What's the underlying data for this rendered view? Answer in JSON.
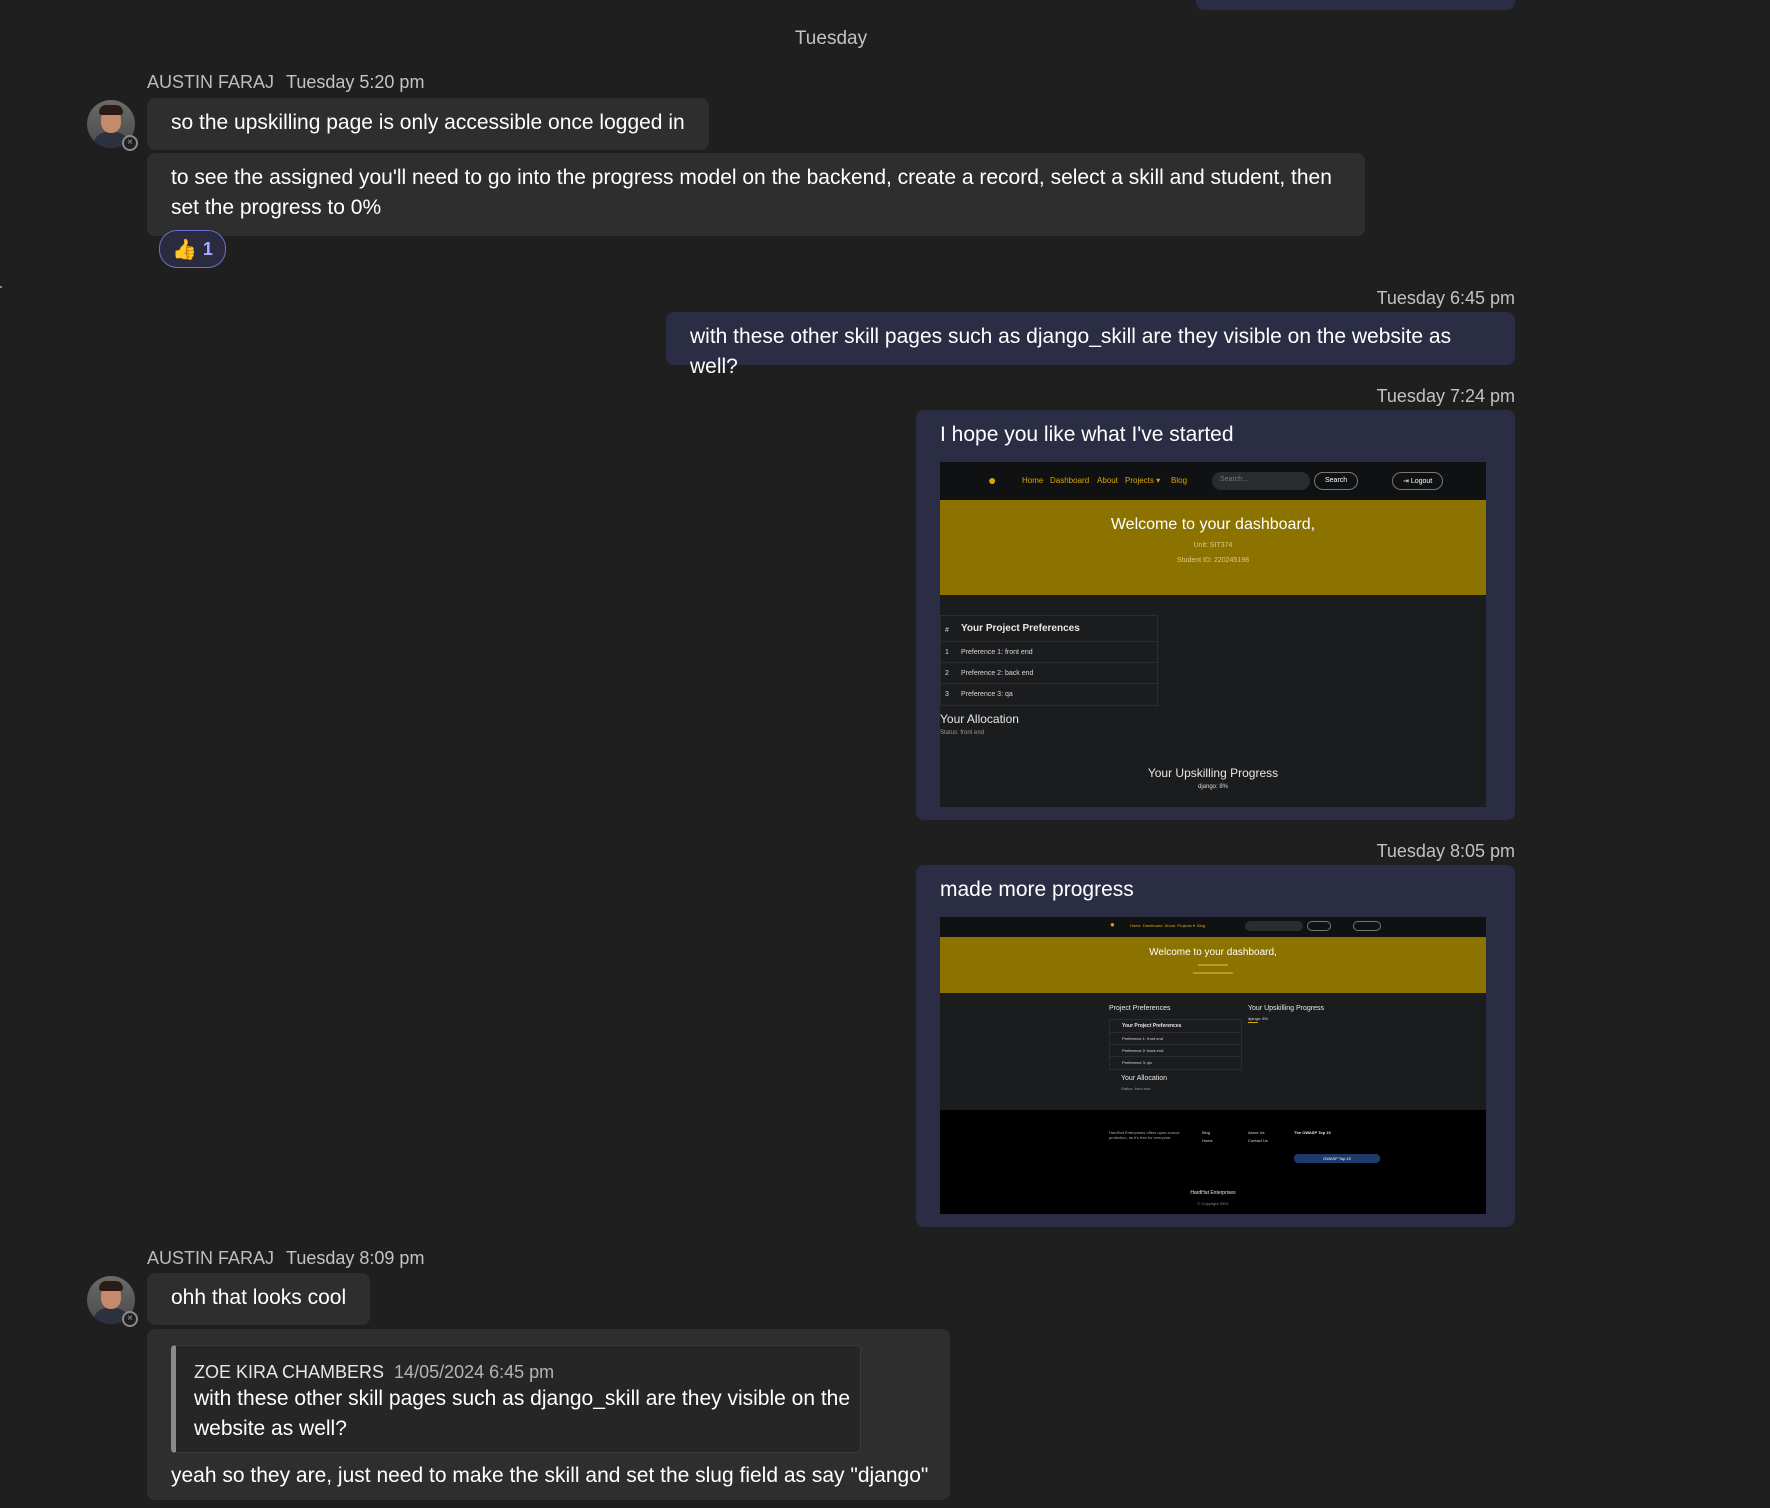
{
  "date_separator": "Tuesday",
  "messages": [
    {
      "sender": "AUSTIN FARAJ",
      "time": "Tuesday 5:20 pm",
      "lines": [
        "so the upskilling page is only accessible once logged in",
        "to see the assigned you'll need to go into the progress model on the backend, create a record, select a skill and student, then set the progress to 0%"
      ],
      "reaction": {
        "icon": "thumbs-up-icon",
        "emoji": "👍",
        "count": "1"
      }
    },
    {
      "time": "Tuesday 6:45 pm",
      "text": "with these other skill pages such as django_skill are they visible on the website as well?"
    },
    {
      "time": "Tuesday 7:24 pm",
      "text": "I hope you like what I've started"
    },
    {
      "time": "Tuesday 8:05 pm",
      "text": "made more progress"
    },
    {
      "sender": "AUSTIN FARAJ",
      "time": "Tuesday 8:09 pm",
      "text": "ohh that looks cool",
      "quote": {
        "author": "ZOE KIRA CHAMBERS",
        "date": "14/05/2024 6:45 pm",
        "text": "with these other skill pages such as django_skill are they visible on the website as well?"
      },
      "reply": "yeah so they are, just need to make the skill and set the slug field as say \"django\""
    }
  ],
  "screenshot1": {
    "nav": {
      "home": "Home",
      "dashboard": "Dashboard",
      "about": "About",
      "projects": "Projects ▾",
      "blog": "Blog",
      "search_placeholder": "Search...",
      "search_btn": "Search",
      "logout": "Logout"
    },
    "hero_title": "Welcome to your dashboard,",
    "unit": "Unit: SIT374",
    "student_id": "Student ID: 220245198",
    "pref_heading": "Your Project Preferences",
    "pref_hash": "#",
    "prefs": [
      {
        "n": "1",
        "t": "Preference 1: front end"
      },
      {
        "n": "2",
        "t": "Preference 2: back end"
      },
      {
        "n": "3",
        "t": "Preference 3: qa"
      }
    ],
    "allocation_heading": "Your Allocation",
    "allocation_status": "Status: front end",
    "upskilling_heading": "Your Upskilling Progress",
    "upskilling_value": "django: 8%"
  },
  "screenshot2": {
    "hero_title": "Welcome to your dashboard,",
    "pref_section": "Project Preferences",
    "up_section": "Your Upskilling Progress",
    "up_value": "django: 8%",
    "pref_heading": "Your Project Preferences",
    "prefs": [
      {
        "n": "1",
        "t": "Preference 1: front end"
      },
      {
        "n": "2",
        "t": "Preference 2: back end"
      },
      {
        "n": "3",
        "t": "Preference 3: qa"
      }
    ],
    "allocation_heading": "Your Allocation",
    "allocation_status": "Status: front end",
    "footer_about": "HardHat Enterprises offers open-source protection, as it's free for everyone.",
    "footer_links": [
      "Blog",
      "Home",
      "About Us",
      "Contact Us"
    ],
    "footer_owasp_title": "The OWASP Top 10",
    "footer_owasp_btn": "OWASP Top 10",
    "footer_brand": "HardHat Enterprises",
    "footer_copy": "© Copyright 2024"
  }
}
